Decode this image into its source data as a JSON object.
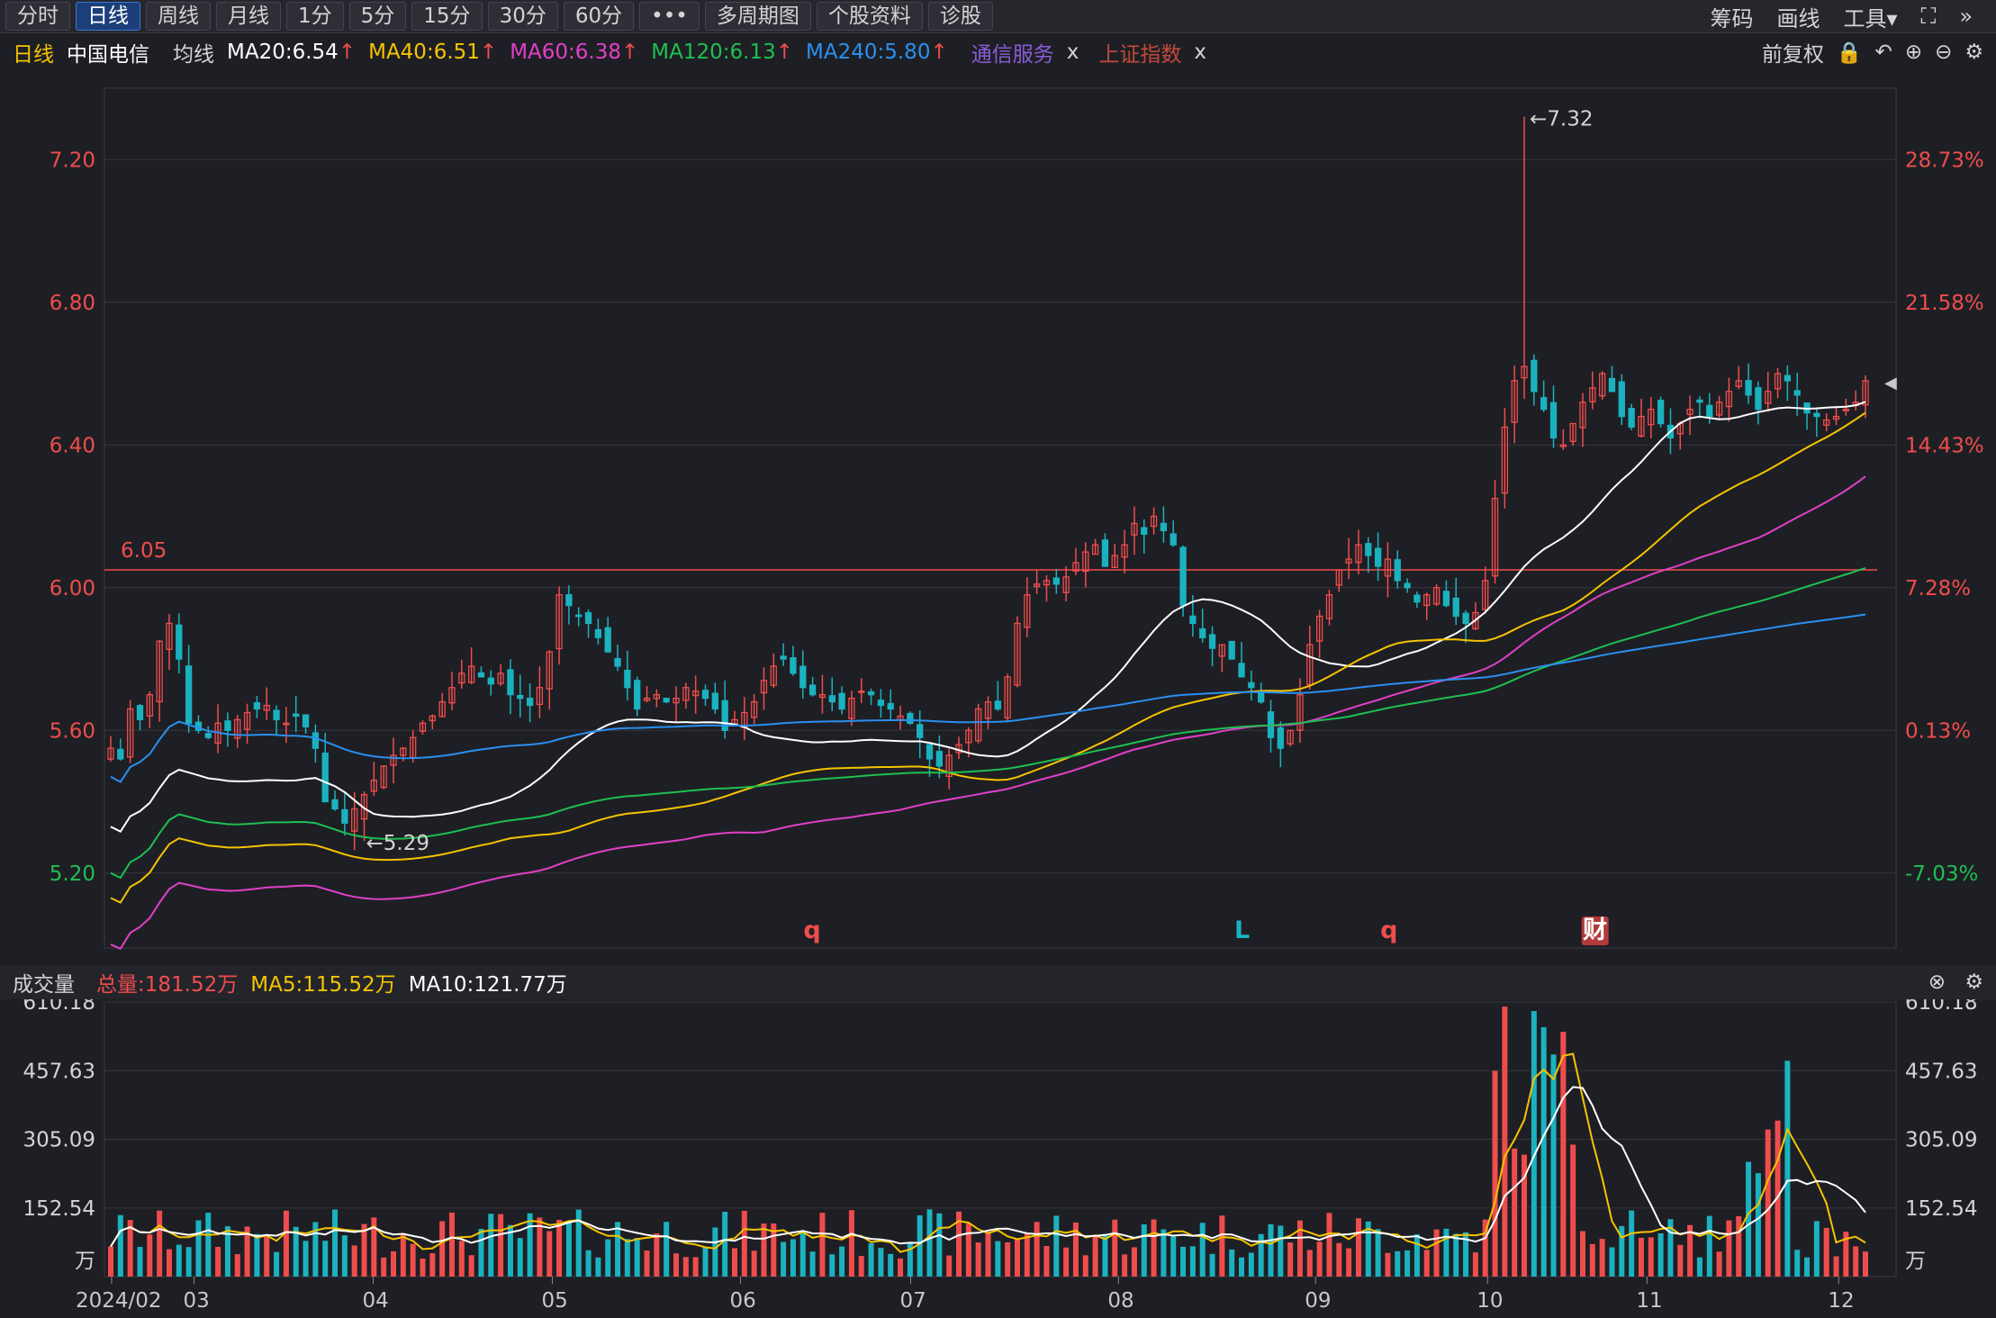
{
  "toolbar": {
    "periods": [
      "分时",
      "日线",
      "周线",
      "月线",
      "1分",
      "5分",
      "15分",
      "30分",
      "60分",
      "•••"
    ],
    "active": "日线",
    "multi_period": "多周期图",
    "stock_info": "个股资料",
    "diagnose": "诊股",
    "right": [
      "筹码",
      "画线",
      "工具▾"
    ]
  },
  "legend": {
    "period": "日线",
    "stock": "中国电信",
    "ma_label": "均线",
    "ma": [
      {
        "text": "MA20:6.54",
        "color": "#ffffff"
      },
      {
        "text": "MA40:6.51",
        "color": "#f5c400"
      },
      {
        "text": "MA60:6.38",
        "color": "#e040c8"
      },
      {
        "text": "MA120:6.13",
        "color": "#1fbf52"
      },
      {
        "text": "MA240:5.80",
        "color": "#2a90f0"
      }
    ],
    "overlays": [
      {
        "text": "通信服务",
        "color": "#8a5cd8"
      },
      {
        "text": "上证指数",
        "color": "#c24a3a"
      }
    ],
    "close_x": "x",
    "adjust": "前复权"
  },
  "colors": {
    "up": "#ef4d4d",
    "down": "#1bb2c0",
    "grid": "#35363d",
    "ref": "#ef4d4d"
  },
  "icons": [
    "lock-icon",
    "undo-icon",
    "zoom-in-icon",
    "zoom-out-icon",
    "gear-icon",
    "fullscreen-icon",
    "more-icon",
    "close-icon"
  ],
  "price_axis": {
    "ticks": [
      "7.20",
      "6.80",
      "6.40",
      "6.00",
      "5.60",
      "5.20"
    ],
    "values": [
      7.2,
      6.8,
      6.4,
      6.0,
      5.6,
      5.2
    ],
    "ymin": 4.99,
    "ymax": 7.4
  },
  "pct_axis": {
    "ticks": [
      "28.73%",
      "21.58%",
      "14.43%",
      "7.28%",
      "0.13%",
      "-7.03%"
    ],
    "colors": [
      "#ef4d4d",
      "#ef4d4d",
      "#ef4d4d",
      "#ef4d4d",
      "#ef4d4d",
      "#1fbf52"
    ]
  },
  "ref_line": {
    "value": 6.05,
    "label": "6.05"
  },
  "annotations": {
    "high": "←7.32",
    "low": "←5.29"
  },
  "markers": [
    {
      "label": "q",
      "x_frac": 0.395,
      "color": "#ef4d4d"
    },
    {
      "label": "L",
      "x_frac": 0.635,
      "color": "#1bb2c0"
    },
    {
      "label": "q",
      "x_frac": 0.717,
      "color": "#ef4d4d"
    },
    {
      "label": "财",
      "x_frac": 0.832,
      "color": "#ffffff"
    }
  ],
  "x_axis": {
    "labels": [
      "2024/02",
      "03",
      "04",
      "05",
      "06",
      "07",
      "08",
      "09",
      "10",
      "11",
      "12"
    ],
    "positions": [
      0.004,
      0.05,
      0.15,
      0.25,
      0.355,
      0.45,
      0.566,
      0.676,
      0.772,
      0.861,
      0.968
    ]
  },
  "volume": {
    "title": "成交量",
    "total": "总量:181.52万",
    "ma5": "MA5:115.52万",
    "ma10": "MA10:121.77万",
    "ticks": [
      "610.18",
      "457.63",
      "305.09",
      "152.54"
    ],
    "values": [
      610.18,
      457.63,
      305.09,
      152.54
    ],
    "unit": "万",
    "vmax": 610.18
  },
  "chart_data": {
    "type": "candlestick",
    "close_series": [
      5.55,
      5.52,
      5.66,
      5.63,
      5.7,
      5.85,
      5.9,
      5.8,
      5.62,
      5.6,
      5.58,
      5.62,
      5.6,
      5.63,
      5.65,
      5.66,
      5.67,
      5.63,
      5.62,
      5.64,
      5.61,
      5.55,
      5.4,
      5.38,
      5.34,
      5.38,
      5.42,
      5.46,
      5.5,
      5.53,
      5.55,
      5.58,
      5.62,
      5.64,
      5.68,
      5.72,
      5.76,
      5.78,
      5.75,
      5.73,
      5.76,
      5.7,
      5.69,
      5.67,
      5.72,
      5.82,
      5.98,
      5.95,
      5.92,
      5.9,
      5.86,
      5.82,
      5.78,
      5.72,
      5.66,
      5.69,
      5.7,
      5.68,
      5.69,
      5.72,
      5.71,
      5.69,
      5.66,
      5.6,
      5.63,
      5.65,
      5.68,
      5.74,
      5.78,
      5.8,
      5.76,
      5.72,
      5.7,
      5.7,
      5.68,
      5.66,
      5.69,
      5.71,
      5.7,
      5.67,
      5.66,
      5.64,
      5.62,
      5.58,
      5.52,
      5.5,
      5.53,
      5.56,
      5.6,
      5.66,
      5.68,
      5.66,
      5.75,
      5.9,
      5.98,
      6.01,
      6.02,
      6.01,
      6.03,
      6.07,
      6.1,
      6.12,
      6.06,
      6.09,
      6.12,
      6.18,
      6.15,
      6.2,
      6.16,
      6.12,
      5.95,
      5.9,
      5.86,
      5.83,
      5.84,
      5.8,
      5.75,
      5.72,
      5.68,
      5.58,
      5.55,
      5.6,
      5.7,
      5.84,
      5.92,
      5.98,
      6.05,
      6.08,
      6.12,
      6.09,
      6.06,
      6.08,
      6.02,
      6.0,
      5.96,
      5.98,
      6.0,
      5.95,
      5.92,
      5.9,
      5.93,
      6.02,
      6.25,
      6.45,
      6.58,
      6.62,
      6.55,
      6.5,
      6.42,
      6.4,
      6.46,
      6.52,
      6.56,
      6.6,
      6.55,
      6.48,
      6.45,
      6.48,
      6.5,
      6.46,
      6.42,
      6.46,
      6.5,
      6.52,
      6.48,
      6.52,
      6.55,
      6.58,
      6.54,
      6.5,
      6.55,
      6.6,
      6.58,
      6.54,
      6.49,
      6.48,
      6.47,
      6.48,
      6.5,
      6.52,
      6.58
    ],
    "ma": [
      "MA20",
      "MA40",
      "MA60",
      "MA120",
      "MA240"
    ],
    "high": 7.32,
    "low": 5.29,
    "ylim": [
      4.99,
      7.4
    ]
  }
}
